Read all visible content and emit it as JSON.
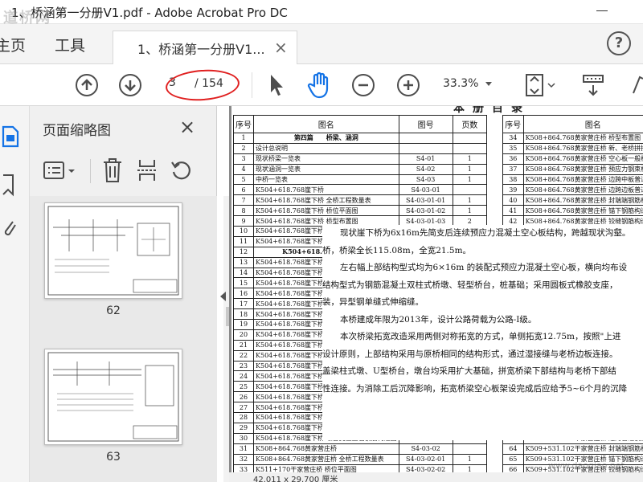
{
  "window": {
    "title": "1、桥涵第一分册V1.pdf - Adobe Acrobat Pro DC",
    "watermark": "道桥网"
  },
  "tabs": {
    "home": "主页",
    "tools": "工具",
    "document": "1、桥涵第一分册V1...",
    "close": "×",
    "help": "?"
  },
  "toolbar": {
    "page_current": "3",
    "page_total": "/ 154",
    "zoom": "33.3%"
  },
  "panel": {
    "title": "页面缩略图",
    "close": "×",
    "thumbnails": [
      {
        "label": "62"
      },
      {
        "label": "63"
      }
    ]
  },
  "document": {
    "sheet_title": "本册目录",
    "left_table": {
      "headers": [
        "序号",
        "图名",
        "图号",
        "页数"
      ],
      "rows": [
        [
          "1",
          "第四篇　　桥梁、涵洞",
          "",
          ""
        ],
        [
          "2",
          "设计总说明",
          "",
          ""
        ],
        [
          "3",
          "现状桥梁一览表",
          "S4-01",
          "1"
        ],
        [
          "4",
          "现状涵洞一览表",
          "S4-02",
          "1"
        ],
        [
          "5",
          "中桥一览表",
          "S4-03",
          "1"
        ],
        [
          "6",
          "K504+618.768崖下桥",
          "S4-03-01",
          ""
        ],
        [
          "7",
          "K504+618.768崖下桥 全桥工程数量表",
          "S4-03-01-01",
          "1"
        ],
        [
          "8",
          "K504+618.768崖下桥 桥位平面图",
          "S4-03-01-02",
          "1"
        ],
        [
          "9",
          "K504+618.768崖下桥 桥型布置图",
          "S4-03-01-03",
          "2"
        ],
        [
          "10",
          "K504+618.768崖下桥 桥",
          "",
          ""
        ],
        [
          "11",
          "K504+618.768崖下桥 桥",
          "",
          ""
        ],
        [
          "12",
          "K504+618.768崖下桥 空心",
          "",
          ""
        ],
        [
          "13",
          "K504+618.768崖下桥 中",
          "",
          ""
        ],
        [
          "14",
          "K504+618.768崖下桥 预",
          "",
          ""
        ],
        [
          "15",
          "K504+618.768崖下桥 边",
          "",
          ""
        ],
        [
          "16",
          "K504+618.768崖下桥 中",
          "",
          ""
        ],
        [
          "17",
          "K504+618.768崖下桥 桥",
          "",
          ""
        ],
        [
          "18",
          "K504+618.768崖下桥 钢",
          "",
          ""
        ],
        [
          "19",
          "K504+618.768崖下桥 钢",
          "",
          ""
        ],
        [
          "20",
          "K504+618.768崖下桥 钢",
          "",
          ""
        ],
        [
          "21",
          "K504+618.768崖下桥 钢",
          "",
          ""
        ],
        [
          "22",
          "K504+618.768崖下桥 铰",
          "",
          ""
        ],
        [
          "23",
          "K504+618.768崖下桥 桥",
          "",
          ""
        ],
        [
          "24",
          "K504+618.768崖下桥 桥",
          "",
          ""
        ],
        [
          "25",
          "K504+618.768崖下桥 桥",
          "",
          ""
        ],
        [
          "26",
          "K504+618.768崖下桥 桥台桩身钢筋构造图",
          "S4-03-01-21",
          "1"
        ],
        [
          "27",
          "K504+618.768崖下桥 桥台背墙钢筋构造图",
          "S4-03-01-22",
          "1"
        ],
        [
          "28",
          "K504+618.768崖下桥 桥台挡块钢筋构造图",
          "S4-03-01-22",
          "1"
        ],
        [
          "29",
          "K504+618.768崖下桥 支座预埋钢筋构造图",
          "S4-03-01-23",
          "1"
        ],
        [
          "30",
          "K504+618.768崖下桥 墩台支座垫石钢筋构造图",
          "S4-03-01-24",
          "2"
        ],
        [
          "31",
          "K508+864.768黄家营庄桥",
          "S4-03-02",
          ""
        ],
        [
          "32",
          "K508+864.768黄家营庄桥 全桥工程数量表",
          "S4-03-02-01",
          "1"
        ],
        [
          "33",
          "K511+170干家营庄桥 桥位平面图",
          "S4-03-02-02",
          "1"
        ]
      ]
    },
    "right_table": {
      "headers": [
        "序号",
        "图名"
      ],
      "rows": [
        [
          "34",
          "K508+864.768黄家营庄桥 桥型布置图"
        ],
        [
          "35",
          "K508+864.768黄家营庄桥 新、老桥拼接设"
        ],
        [
          "36",
          "K508+864.768黄家营庄桥 空心板一般构造"
        ],
        [
          "37",
          "K508+864.768黄家营庄桥 预应力钢束构造"
        ],
        [
          "38",
          "K508+864.768黄家营庄桥 边跨中板普通钢"
        ],
        [
          "39",
          "K508+864.768黄家营庄桥 边跨边板普通钢"
        ],
        [
          "40",
          "K508+864.768黄家营庄桥 封端端钢筋构造"
        ],
        [
          "41",
          "K508+864.768黄家营庄桥 锚下钢筋构造图"
        ],
        [
          "42",
          "K508+864.768黄家营庄桥 铰缝钢筋构造图"
        ],
        [
          "43",
          ""
        ],
        [
          "44",
          ""
        ],
        [
          "45",
          ""
        ],
        [
          "46",
          ""
        ],
        [
          "47",
          ""
        ],
        [
          "48",
          ""
        ],
        [
          "49",
          ""
        ],
        [
          "50",
          ""
        ],
        [
          "51",
          ""
        ],
        [
          "52",
          ""
        ],
        [
          "53",
          ""
        ],
        [
          "54",
          ""
        ],
        [
          "55",
          ""
        ],
        [
          "56",
          ""
        ],
        [
          "57",
          ""
        ],
        [
          "58",
          ""
        ],
        [
          "59",
          "K509+531.102干家营庄桥 新、老桥拼接设"
        ],
        [
          "60",
          "K509+531.102干家营庄桥 空心板一般构造"
        ],
        [
          "61",
          "K509+531.102干家营庄桥 预应力钢束构造"
        ],
        [
          "62",
          "K509+531.102干家营庄桥 中跨普通钢筋构造"
        ],
        [
          "63",
          "K509+531.102干家营庄桥 边跨普通钢筋构造"
        ],
        [
          "64",
          "K509+531.102干家营庄桥 封端端钢筋构造"
        ],
        [
          "65",
          "K509+531.102干家营庄桥 锚下钢筋构造图"
        ],
        [
          "66",
          "K509+531.102干家营庄桥 铰缝钢筋构造图"
        ]
      ]
    },
    "overlay_paragraphs": [
      "现状崖下桥为6x16m先简支后连续预应力混凝土空心板结构，跨越现状沟壑。",
      "桥，桥梁全长115.08m，全宽21.5m。",
      "左右幅上部结构型式均为6×16m 的装配式预应力混凝土空心板，横向均布设",
      "结构型式为钢筋混凝土双柱式桥墩、轻型桥台，桩基础；采用圆板式橡胶支座，",
      "装，异型钢单缝式伸缩缝。",
      "本桥建成年限为2013年，设计公路荷载为公路-I级。",
      "本次桥梁拓宽改造采用两侧对称拓宽的方式，单侧拓宽12.75m，按照\"上进",
      "设计原则，上部结构采用与原桥相同的结构形式，通过湿接缝与老桥边板连接。",
      "盖梁柱式墩、U型桥台，墩台均采用扩大基础，拼宽桥梁下部结构与老桥下部结",
      "性连接。为消除工后沉降影响，拓宽桥梁空心板架设完成后应给予5~6个月的沉降"
    ],
    "status_text": "42.011 x 29.700 厘米",
    "site_watermark": "www.daoqiao.net"
  },
  "colors": {
    "annotation_red": "#e02020",
    "hand_tool_blue": "#1473e6"
  }
}
